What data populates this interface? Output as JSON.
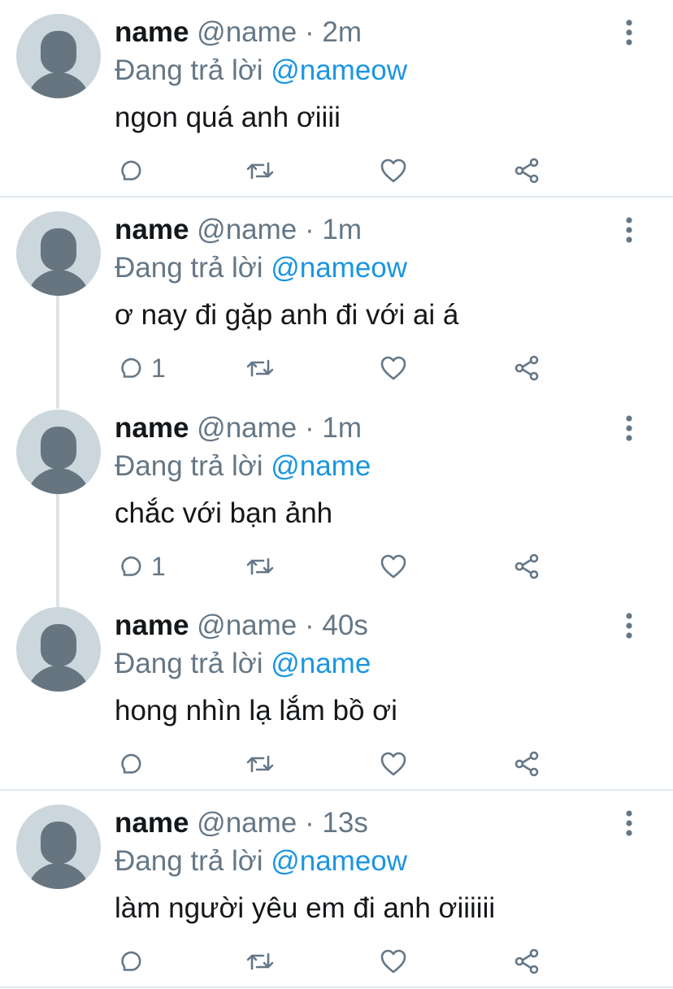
{
  "tweets": [
    {
      "name": "name",
      "handle": "@name",
      "time": "2m",
      "reply_prefix": "Đang trả lời",
      "reply_to": "@nameow",
      "text": "ngon quá anh ơiiii",
      "reply_count": ""
    },
    {
      "name": "name",
      "handle": "@name",
      "time": "1m",
      "reply_prefix": "Đang trả lời",
      "reply_to": "@nameow",
      "text": "ơ nay đi gặp anh đi với ai á",
      "reply_count": "1"
    },
    {
      "name": "name",
      "handle": "@name",
      "time": "1m",
      "reply_prefix": "Đang trả lời",
      "reply_to": "@name",
      "text": "chắc với bạn ảnh",
      "reply_count": "1"
    },
    {
      "name": "name",
      "handle": "@name",
      "time": "40s",
      "reply_prefix": "Đang trả lời",
      "reply_to": "@name",
      "text": "hong nhìn lạ lắm bồ ơi",
      "reply_count": ""
    },
    {
      "name": "name",
      "handle": "@name",
      "time": "13s",
      "reply_prefix": "Đang trả lời",
      "reply_to": "@nameow",
      "text": "làm người yêu em đi anh ơiiiiii",
      "reply_count": ""
    }
  ],
  "meta_separator": "·",
  "icons": {
    "reply": "reply-icon",
    "retweet": "retweet-icon",
    "like": "heart-icon",
    "share": "share-icon",
    "more": "more-vertical-icon",
    "avatar": "default-avatar-icon"
  },
  "colors": {
    "text": "#14171a",
    "secondary": "#657786",
    "mention": "#1b95e0",
    "avatar_bg": "#ccd6dd",
    "avatar_fg": "#66757f",
    "divider": "#e1e8ed",
    "thread_line": "#dfe4e8"
  }
}
